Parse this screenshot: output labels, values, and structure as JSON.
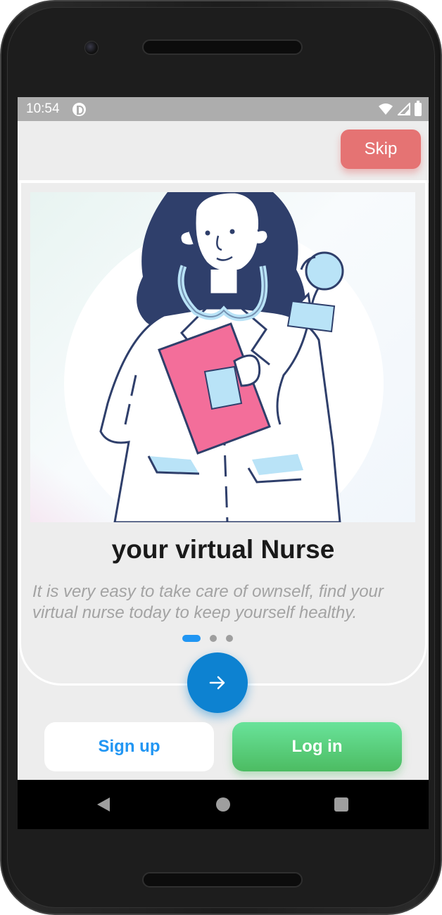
{
  "status_bar": {
    "time": "10:54"
  },
  "top_bar": {
    "skip_label": "Skip"
  },
  "onboarding": {
    "title": "your virtual Nurse",
    "description": "It is very easy to take care of ownself, find your virtual nurse today to keep yourself healthy.",
    "page_count": 3,
    "current_page": 1
  },
  "actions": {
    "signup_label": "Sign up",
    "login_label": "Log in"
  },
  "colors": {
    "skip_button": "#e57373",
    "accent_blue": "#2196f3",
    "next_button": "#0d82d1",
    "login_green": "#4cbc62",
    "nurse_hair": "#2f3f6b",
    "clipboard_pink": "#f36e9a",
    "stethoscope_blue": "#b9e3f7"
  },
  "icons": {
    "next": "arrow-right-icon",
    "back": "triangle-back-icon",
    "home": "circle-home-icon",
    "recents": "square-recents-icon"
  }
}
